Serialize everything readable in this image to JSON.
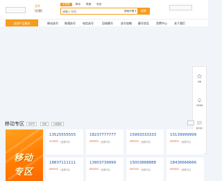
{
  "header": {
    "city": "北京",
    "city_switch": "[切换]",
    "search_tabs": [
      "手机号",
      "移动",
      "联通",
      "电信"
    ],
    "search_placeholder": "请输入号码",
    "search_filter": "搜索不限 ▾",
    "search_button": "搜索"
  },
  "nav": {
    "category_label": "全部产品服务",
    "items": [
      "移动选号",
      "联通选号",
      "电信选号",
      "回收靓号",
      "选号攻略",
      "靓号验证",
      "资费中心",
      "关于我们"
    ]
  },
  "sidebar_float": {
    "items": [
      {
        "label": "收藏",
        "icon": "star-icon"
      },
      {
        "label": "在线客服",
        "icon": "bell-icon"
      },
      {
        "label": "联系我们",
        "icon": "message-icon"
      },
      {
        "label": "返回",
        "icon": "back-to-top-icon"
      }
    ]
  },
  "section": {
    "title": "移动专区",
    "filters": [
      "同步号",
      "优质",
      "价格更新"
    ],
    "promo_lines": [
      "移动",
      "专区"
    ]
  },
  "numbers": [
    {
      "number": "13525555555",
      "price": "¥14800",
      "fee": "(含费0元)"
    },
    {
      "number": "18237777777",
      "price": "¥69800",
      "fee": "(含费0元)"
    },
    {
      "number": "15993333333",
      "price": "¥68000",
      "fee": "(含费0元)"
    },
    {
      "number": "15139999999",
      "price": "¥69800",
      "fee": "(含费0元)"
    },
    {
      "number": "18837111111",
      "price": "¥66000",
      "fee": "(含费0元)"
    },
    {
      "number": "13903739999",
      "price": "¥60800",
      "fee": "(含费0元)"
    },
    {
      "number": "15003888888",
      "price": "¥63000",
      "fee": "(含费0元)"
    },
    {
      "number": "18436666666",
      "price": "¥69800",
      "fee": "(含费0元)"
    }
  ],
  "colors": {
    "accent": "#f79c1b",
    "number_blue": "#1a5bb8",
    "price_red": "#f25a24"
  }
}
